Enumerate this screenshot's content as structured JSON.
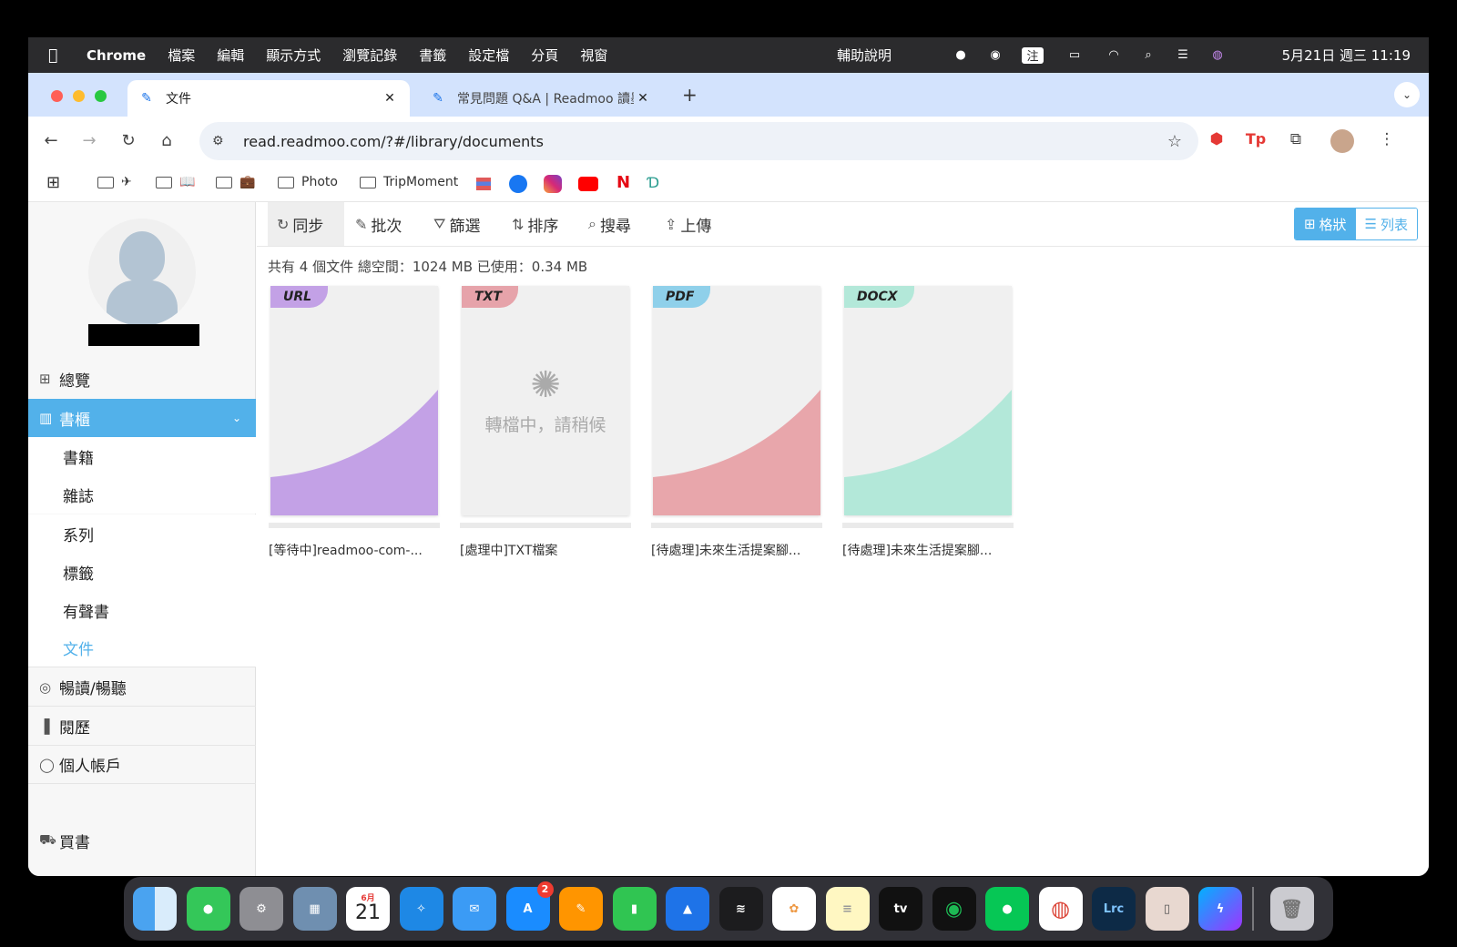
{
  "menubar": {
    "app": "Chrome",
    "items": [
      "檔案",
      "編輯",
      "顯示方式",
      "瀏覽記錄",
      "書籤",
      "設定檔",
      "分頁",
      "視窗"
    ],
    "help": "輔助說明",
    "clock": "5月21日 週三 11:19",
    "ime": "注"
  },
  "tabs": [
    {
      "label": "文件",
      "active": true
    },
    {
      "label": "常見問題 Q&A | Readmoo 讀墨",
      "active": false
    }
  ],
  "address": {
    "url": "read.readmoo.com/?#/library/documents"
  },
  "bookmarks": {
    "photo": "Photo",
    "tripmoment": "TripMoment"
  },
  "sidebar": {
    "overview": "總覽",
    "bookshelf": "書櫃",
    "sub_items": [
      "書籍",
      "雜誌",
      "系列",
      "標籤",
      "有聲書",
      "文件"
    ],
    "current_sub": "文件",
    "unlimited": "暢讀/暢聽",
    "history": "閱歷",
    "account": "個人帳戶",
    "buy": "買書"
  },
  "actions": {
    "sync": "同步",
    "batch": "批次",
    "filter": "篩選",
    "sort": "排序",
    "search": "搜尋",
    "upload": "上傳",
    "view_grid": "格狀",
    "view_list": "列表"
  },
  "summary": "共有 4 個文件 總空間：1024 MB 已使用：0.34 MB",
  "documents": [
    {
      "badge": "URL",
      "title": "[等待中]readmoo-com-...",
      "color": "#c3a1e6",
      "badge_color": "#c3a1e6"
    },
    {
      "badge": "TXT",
      "title": "[處理中]TXT檔案",
      "status": "轉檔中，請稍候",
      "badge_color": "#e6a3aa"
    },
    {
      "badge": "PDF",
      "title": "[待處理]未來生活提案腳...",
      "color": "#e8a6ab",
      "badge_color": "#8fd0ea"
    },
    {
      "badge": "DOCX",
      "title": "[待處理]未來生活提案腳...",
      "color": "#b3e8d9",
      "badge_color": "#b3e8d9"
    }
  ],
  "dock": {
    "calendar_month": "6月",
    "calendar_day": "21",
    "appstore_badge": "2",
    "tv": "tv",
    "lrc": "Lrc"
  }
}
